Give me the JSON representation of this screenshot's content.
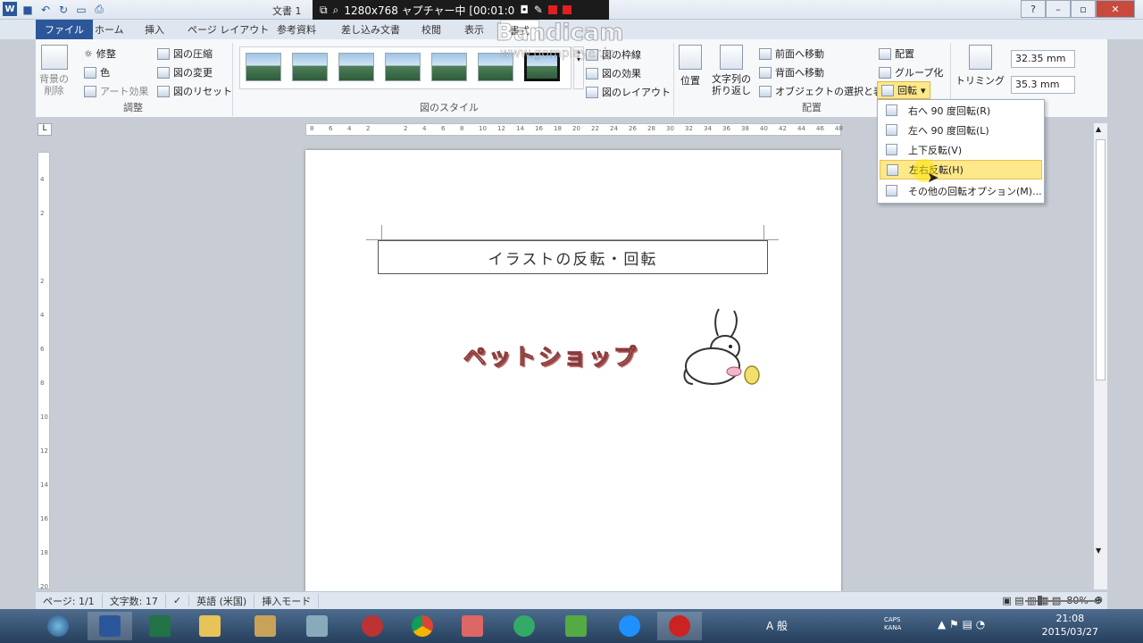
{
  "window": {
    "title": "文書 1",
    "recording": "1280x768 ャプチャー中 [00:01:0",
    "watermark": "Bandicam",
    "watermark_url": "www.gomplayer.jp"
  },
  "tabs": {
    "file": "ファイル",
    "items": [
      "ホーム",
      "挿入",
      "ページ レイアウト",
      "参考資料",
      "差し込み文書",
      "校閲",
      "表示",
      "書式"
    ]
  },
  "ribbon": {
    "adjust": {
      "remove_bg": "背景の\n削除",
      "corrections": "修整",
      "color": "色",
      "art": "アート効果",
      "compress": "図の圧縮",
      "change": "図の変更",
      "reset": "図のリセット",
      "label": "調整"
    },
    "styles": {
      "border": "図の枠線",
      "effects": "図の効果",
      "layout": "図のレイアウト",
      "label": "図のスタイル"
    },
    "arrange": {
      "position": "位置",
      "wrap": "文字列の\n折り返し",
      "forward": "前面へ移動",
      "backward": "背面へ移動",
      "selection": "オブジェクトの選択と表示",
      "align": "配置",
      "group": "グループ化",
      "rotate": "回転",
      "label": "配置"
    },
    "size": {
      "crop": "トリミング",
      "height": "32.35 mm",
      "width": "35.3 mm"
    }
  },
  "rotate_menu": {
    "items": [
      "右へ 90 度回転(R)",
      "左へ 90 度回転(L)",
      "上下反転(V)",
      "左右反転(H)",
      "その他の回転オプション(M)..."
    ]
  },
  "document": {
    "title_box": "イラストの反転・回転",
    "wordart": "ペットショップ"
  },
  "ruler_top": [
    "8",
    "6",
    "4",
    "2",
    "",
    "2",
    "4",
    "6",
    "8",
    "10",
    "12",
    "14",
    "16",
    "18",
    "20",
    "22",
    "24",
    "26",
    "28",
    "30",
    "32",
    "34",
    "36",
    "38",
    "40",
    "42",
    "44",
    "46",
    "48"
  ],
  "ruler_left": [
    "4",
    "2",
    "",
    "2",
    "4",
    "6",
    "8",
    "10",
    "12",
    "14",
    "16",
    "18",
    "20"
  ],
  "status": {
    "page": "ページ: 1/1",
    "words": "文字数: 17",
    "lang": "英語 (米国)",
    "mode": "挿入モード",
    "zoom": "80%"
  },
  "taskbar": {
    "time": "21:08",
    "date": "2015/03/27",
    "ime": "A 般",
    "caps": "CAPS KANA"
  },
  "colors": {
    "accent": "#2b579a",
    "highlight": "#fde88a"
  }
}
